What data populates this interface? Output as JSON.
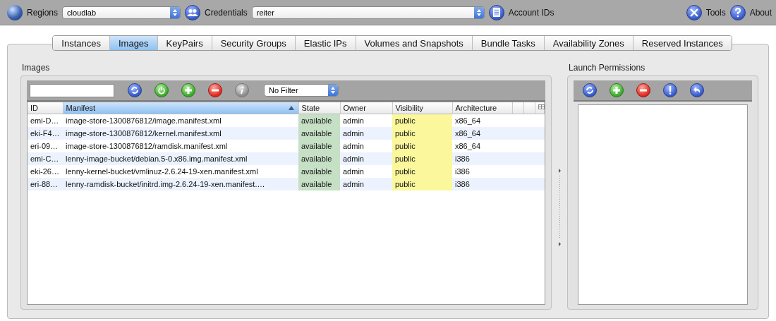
{
  "toolbar": {
    "regions_label": "Regions",
    "region": "cloudlab",
    "credentials_label": "Credentials",
    "credential": "reiter",
    "account_ids": "Account IDs",
    "tools": "Tools",
    "about": "About"
  },
  "tabs": [
    {
      "label": "Instances",
      "selected": false
    },
    {
      "label": "Images",
      "selected": true
    },
    {
      "label": "KeyPairs",
      "selected": false
    },
    {
      "label": "Security Groups",
      "selected": false
    },
    {
      "label": "Elastic IPs",
      "selected": false
    },
    {
      "label": "Volumes and Snapshots",
      "selected": false
    },
    {
      "label": "Bundle Tasks",
      "selected": false
    },
    {
      "label": "Availability Zones",
      "selected": false
    },
    {
      "label": "Reserved Instances",
      "selected": false
    }
  ],
  "images": {
    "title": "Images",
    "filter": "No Filter",
    "columns": [
      {
        "label": "ID",
        "kind": "text",
        "sorted": false
      },
      {
        "label": "Manifest",
        "kind": "text",
        "sorted": true
      },
      {
        "label": "State",
        "kind": "state",
        "sorted": false
      },
      {
        "label": "Owner",
        "kind": "text",
        "sorted": false
      },
      {
        "label": "Visibility",
        "kind": "visibility",
        "sorted": false
      },
      {
        "label": "Architecture",
        "kind": "text",
        "sorted": false
      }
    ],
    "rows": [
      [
        "emi-D…",
        "image-store-1300876812/image.manifest.xml",
        "available",
        "admin",
        "public",
        "x86_64"
      ],
      [
        "eki-F4…",
        "image-store-1300876812/kernel.manifest.xml",
        "available",
        "admin",
        "public",
        "x86_64"
      ],
      [
        "eri-09…",
        "image-store-1300876812/ramdisk.manifest.xml",
        "available",
        "admin",
        "public",
        "x86_64"
      ],
      [
        "emi-C…",
        "lenny-image-bucket/debian.5-0.x86.img.manifest.xml",
        "available",
        "admin",
        "public",
        "i386"
      ],
      [
        "eki-26…",
        "lenny-kernel-bucket/vmlinuz-2.6.24-19-xen.manifest.xml",
        "available",
        "admin",
        "public",
        "i386"
      ],
      [
        "eri-88…",
        "lenny-ramdisk-bucket/initrd.img-2.6.24-19-xen.manifest.…",
        "available",
        "admin",
        "public",
        "i386"
      ]
    ]
  },
  "launch_permissions": {
    "title": "Launch Permissions"
  }
}
